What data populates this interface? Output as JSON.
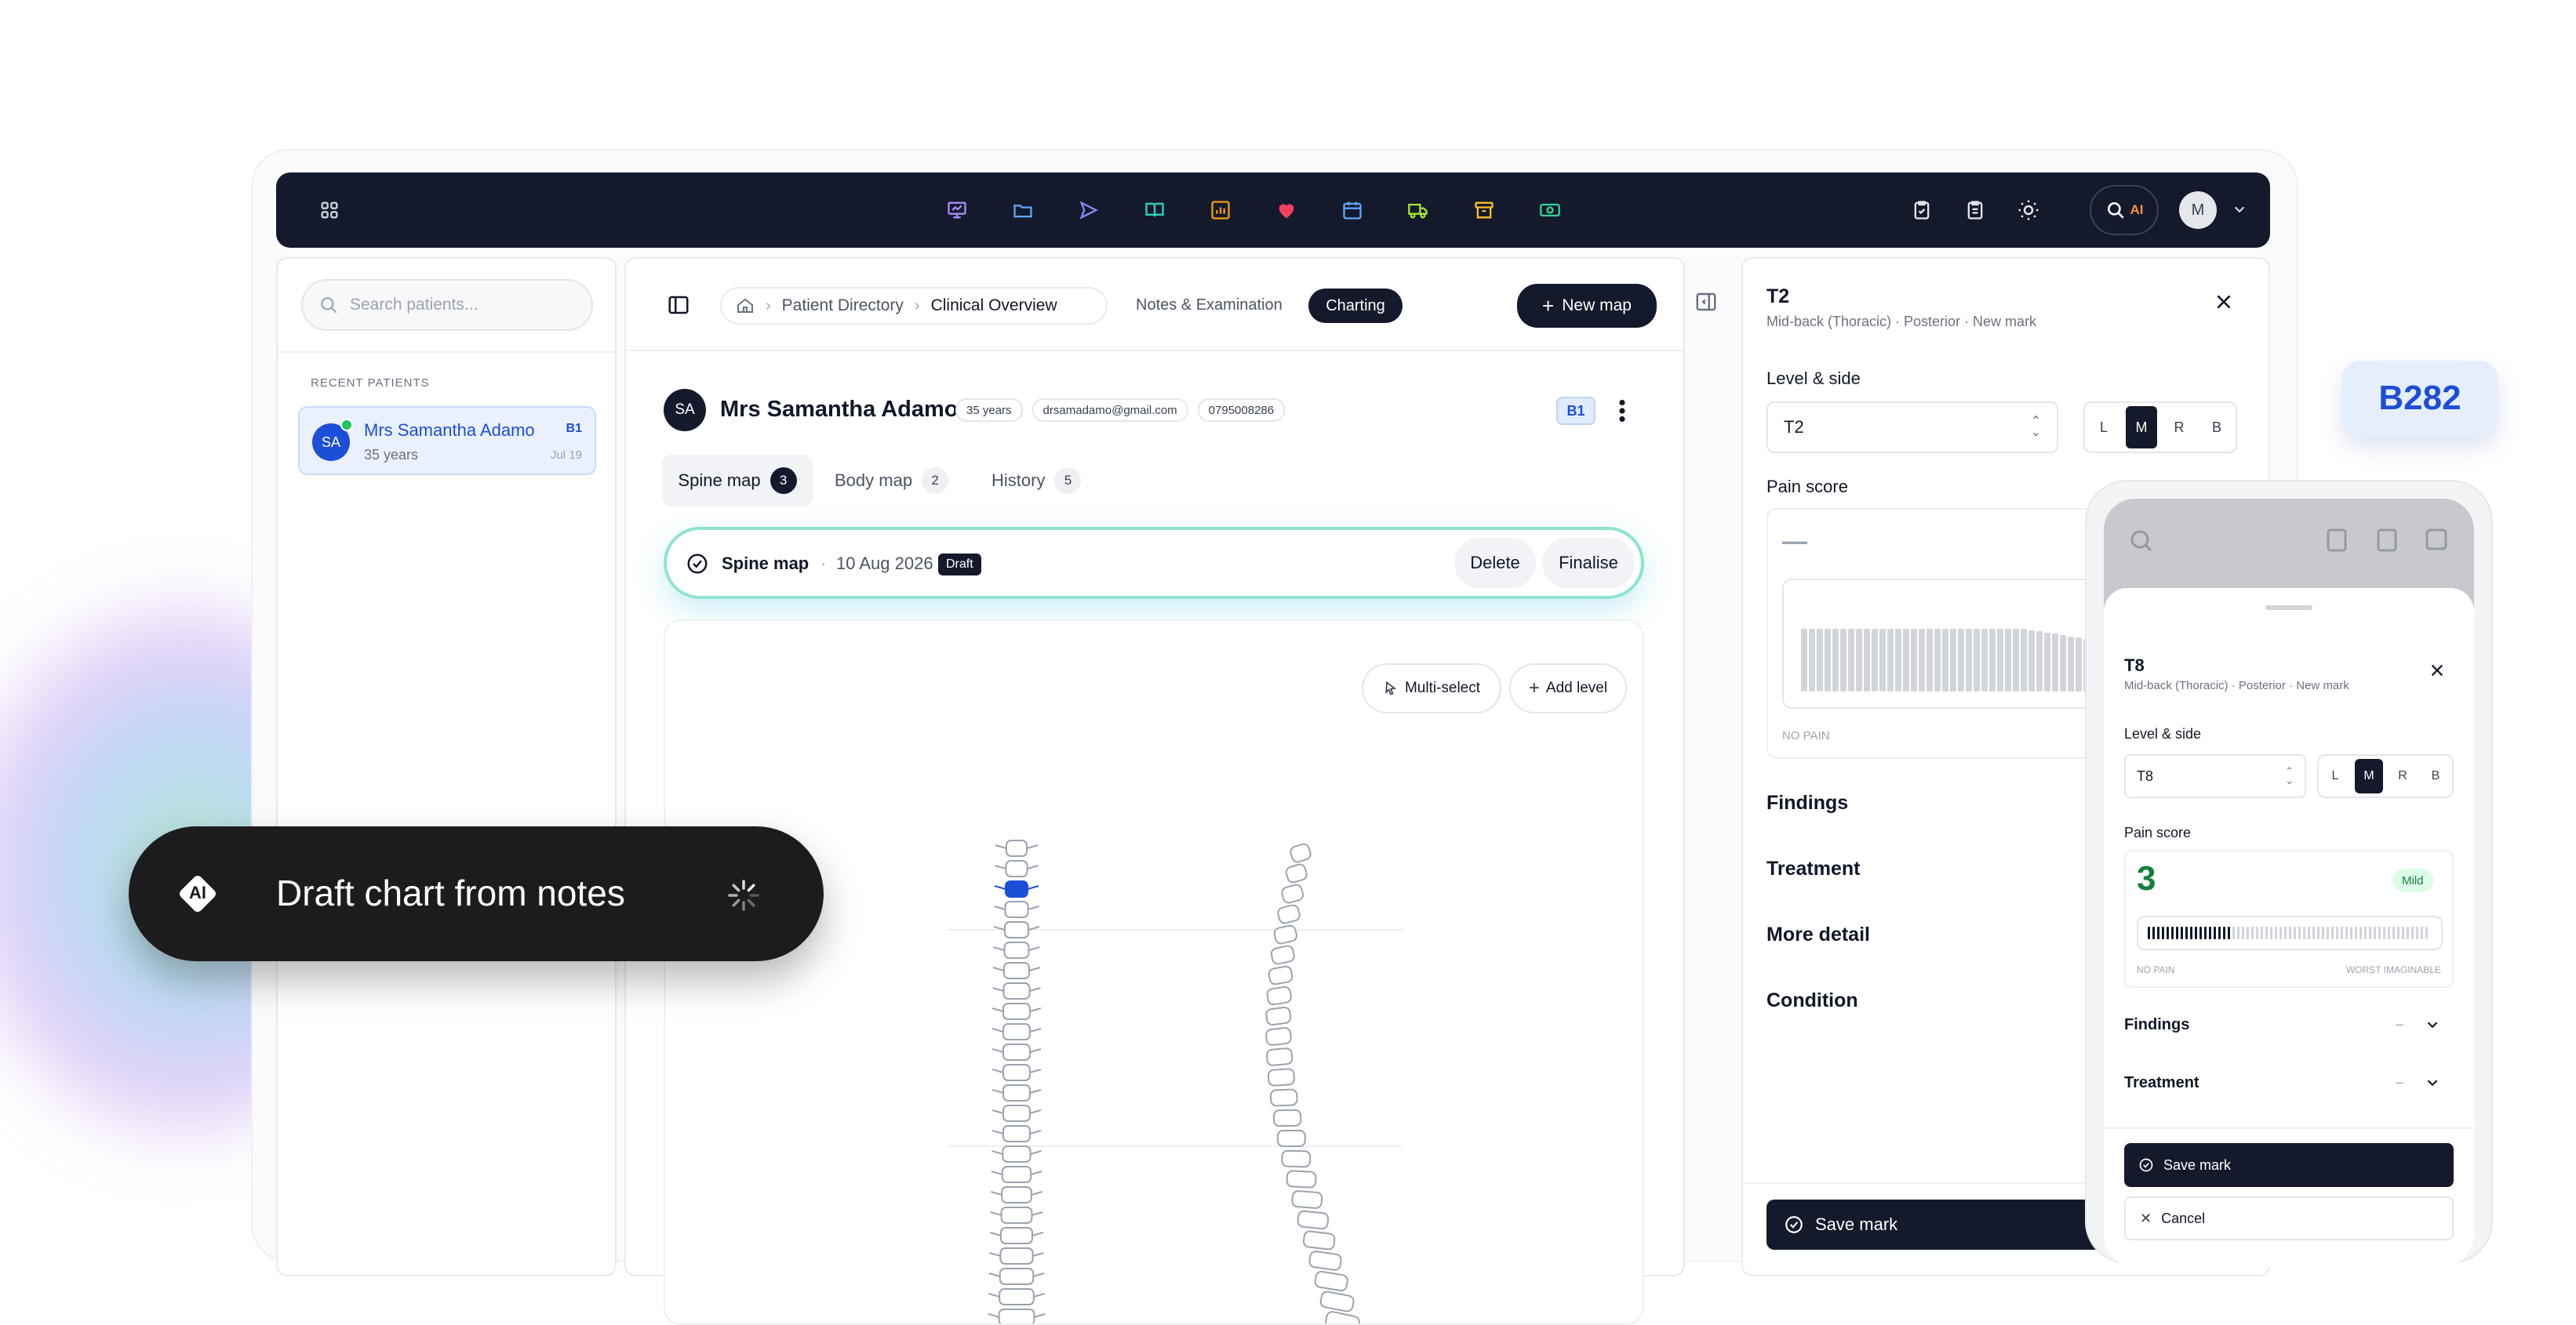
{
  "topbar": {
    "nav_icons": [
      "presentation-icon",
      "folder-icon",
      "send-icon",
      "book-icon",
      "chart-icon",
      "heart-icon",
      "calendar-icon",
      "truck-icon",
      "archive-icon",
      "money-icon"
    ],
    "ai_label": "AI",
    "avatar_initial": "M",
    "colors": {
      "background": "#141a2b",
      "heart": "#f43f5e"
    }
  },
  "sidebar": {
    "search_placeholder": "Search patients...",
    "section_label": "RECENT PATIENTS",
    "patients": [
      {
        "initials": "SA",
        "name": "Mrs Samantha Adamo",
        "age": "35 years",
        "badge": "B1",
        "date": "Jul 19"
      }
    ]
  },
  "header": {
    "breadcrumb": [
      "Patient Directory",
      "Clinical Overview"
    ],
    "tabs": [
      "Notes & Examination",
      "Charting"
    ],
    "active_tab": "Charting",
    "new_map_label": "New map"
  },
  "patient": {
    "initials": "SA",
    "name": "Mrs Samantha Adamo",
    "age": "35 years",
    "email": "drsamadamo@gmail.com",
    "phone": "0795008286",
    "badge": "B1"
  },
  "map_tabs": [
    {
      "label": "Spine map",
      "count": "3"
    },
    {
      "label": "Body map",
      "count": "2"
    },
    {
      "label": "History",
      "count": "5"
    }
  ],
  "draft_bar": {
    "title": "Spine map",
    "date": "10 Aug 2026",
    "status": "Draft",
    "delete_label": "Delete",
    "finalise_label": "Finalise"
  },
  "canvas": {
    "multi_select_label": "Multi-select",
    "add_level_label": "Add level"
  },
  "right_panel": {
    "title": "T2",
    "subtitle": "Mid-back (Thoracic) · Posterior · New mark",
    "level_label": "Level & side",
    "level_value": "T2",
    "sides": [
      "L",
      "M",
      "R",
      "B"
    ],
    "active_side": "M",
    "pain_label": "Pain score",
    "pain_display": "—",
    "no_pain_label": "NO PAIN",
    "sections": [
      "Findings",
      "Treatment",
      "More detail",
      "Condition"
    ],
    "save_label": "Save mark"
  },
  "floating_badge": "B282",
  "ai_pill": {
    "label": "Draft chart from notes",
    "icon_label": "AI"
  },
  "mobile": {
    "title": "T8",
    "subtitle": "Mid-back (Thoracic) · Posterior · New mark",
    "level_label": "Level & side",
    "level_value": "T8",
    "sides": [
      "L",
      "M",
      "R",
      "B"
    ],
    "active_side": "M",
    "pain_label": "Pain score",
    "pain_value": "3",
    "pain_tag": "Mild",
    "pain_fraction": 0.3,
    "no_pain_label": "NO PAIN",
    "worst_label": "WORST IMAGINABLE",
    "sections": [
      {
        "label": "Findings",
        "value": "–"
      },
      {
        "label": "Treatment",
        "value": "–"
      }
    ],
    "save_label": "Save mark",
    "cancel_label": "Cancel",
    "colors": {
      "pain": "#15803d"
    }
  }
}
